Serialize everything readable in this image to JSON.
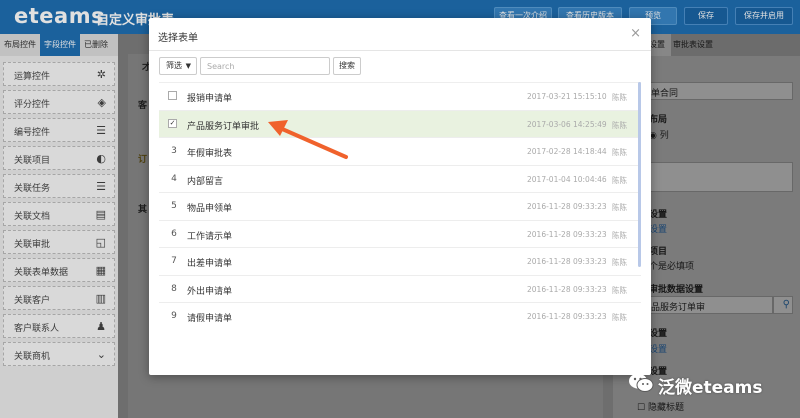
{
  "header": {
    "logo": "eteams",
    "title": "自定义审批表",
    "buttons": [
      "查看一次介绍",
      "查看历史版本",
      "预览",
      "保存",
      "保存并启用"
    ]
  },
  "left_panel": {
    "tabs": [
      "布局控件",
      "字段控件",
      "已删除"
    ],
    "active_tab": 1,
    "controls": [
      {
        "label": "运算控件",
        "icon": "refresh-icon",
        "glyph": "✲"
      },
      {
        "label": "评分控件",
        "icon": "layers-icon",
        "glyph": "◈"
      },
      {
        "label": "编号控件",
        "icon": "list-number-icon",
        "glyph": "☰"
      },
      {
        "label": "关联项目",
        "icon": "pie-icon",
        "glyph": "◐"
      },
      {
        "label": "关联任务",
        "icon": "list-icon",
        "glyph": "☰"
      },
      {
        "label": "关联文档",
        "icon": "document-icon",
        "glyph": "▤"
      },
      {
        "label": "关联审批",
        "icon": "approval-icon",
        "glyph": "◱"
      },
      {
        "label": "关联表单数据",
        "icon": "table-icon",
        "glyph": "▦"
      },
      {
        "label": "关联客户",
        "icon": "bar-chart-icon",
        "glyph": "▥"
      },
      {
        "label": "客户联系人",
        "icon": "person-icon",
        "glyph": "♟"
      },
      {
        "label": "关联商机",
        "icon": "chevron-circle-icon",
        "glyph": "⌄"
      }
    ]
  },
  "canvas": {
    "ghost_texts": [
      "才",
      "客",
      "订",
      "其"
    ]
  },
  "right_panel": {
    "tabs": [
      "设置",
      "审批表设置"
    ],
    "texts": [
      "单合同",
      "布局",
      "列",
      "设置",
      "设置",
      "项目",
      "个是必填项",
      "审批数据设置",
      "品服务订单审",
      "设置",
      "设置",
      "设置",
      "隐藏标题"
    ]
  },
  "modal": {
    "title": "选择表单",
    "close": "×",
    "filter_label": "筛选",
    "search_placeholder": "Search",
    "search_button": "搜索",
    "rows": [
      {
        "marker": "",
        "checkbox": true,
        "checked": false,
        "name": "报销申请单",
        "time": "2017-03-21 15:15:10",
        "user": "陈陈",
        "selected": false
      },
      {
        "marker": "",
        "checkbox": true,
        "checked": true,
        "name": "产品服务订单审批",
        "time": "2017-03-06 14:25:49",
        "user": "陈陈",
        "selected": true
      },
      {
        "marker": "3",
        "checkbox": false,
        "checked": false,
        "name": "年假审批表",
        "time": "2017-02-28 14:18:44",
        "user": "陈陈",
        "selected": false
      },
      {
        "marker": "4",
        "checkbox": false,
        "checked": false,
        "name": "内部留言",
        "time": "2017-01-04 10:04:46",
        "user": "陈陈",
        "selected": false
      },
      {
        "marker": "5",
        "checkbox": false,
        "checked": false,
        "name": "物品申领单",
        "time": "2016-11-28 09:33:23",
        "user": "陈陈",
        "selected": false
      },
      {
        "marker": "6",
        "checkbox": false,
        "checked": false,
        "name": "工作请示单",
        "time": "2016-11-28 09:33:23",
        "user": "陈陈",
        "selected": false
      },
      {
        "marker": "7",
        "checkbox": false,
        "checked": false,
        "name": "出差申请单",
        "time": "2016-11-28 09:33:23",
        "user": "陈陈",
        "selected": false
      },
      {
        "marker": "8",
        "checkbox": false,
        "checked": false,
        "name": "外出申请单",
        "time": "2016-11-28 09:33:23",
        "user": "陈陈",
        "selected": false
      },
      {
        "marker": "9",
        "checkbox": false,
        "checked": false,
        "name": "请假申请单",
        "time": "2016-11-28 09:33:23",
        "user": "陈陈",
        "selected": false
      }
    ]
  },
  "annotation": {
    "arrow_color": "#f0622c"
  },
  "watermark": {
    "text": "泛微eteams"
  },
  "colors": {
    "brand": "#1f6fb2",
    "selected_row": "#e9f2e0"
  }
}
